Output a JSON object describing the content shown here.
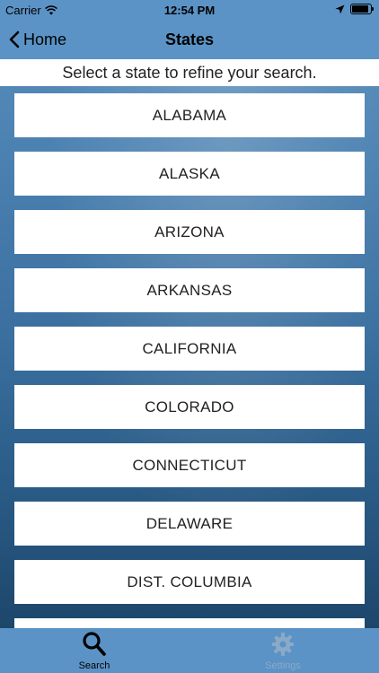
{
  "status_bar": {
    "carrier": "Carrier",
    "time": "12:54 PM"
  },
  "nav": {
    "back_label": "Home",
    "title": "States"
  },
  "prompt": "Select a state to refine your search.",
  "states": [
    "ALABAMA",
    "ALASKA",
    "ARIZONA",
    "ARKANSAS",
    "CALIFORNIA",
    "COLORADO",
    "CONNECTICUT",
    "DELAWARE",
    "DIST. COLUMBIA",
    ""
  ],
  "tabs": {
    "search": {
      "label": "Search",
      "icon": "search-icon"
    },
    "settings": {
      "label": "Settings",
      "icon": "gear-icon"
    }
  },
  "colors": {
    "bar": "#5b93c6",
    "settings_tab_inactive": "#8aaac7"
  }
}
